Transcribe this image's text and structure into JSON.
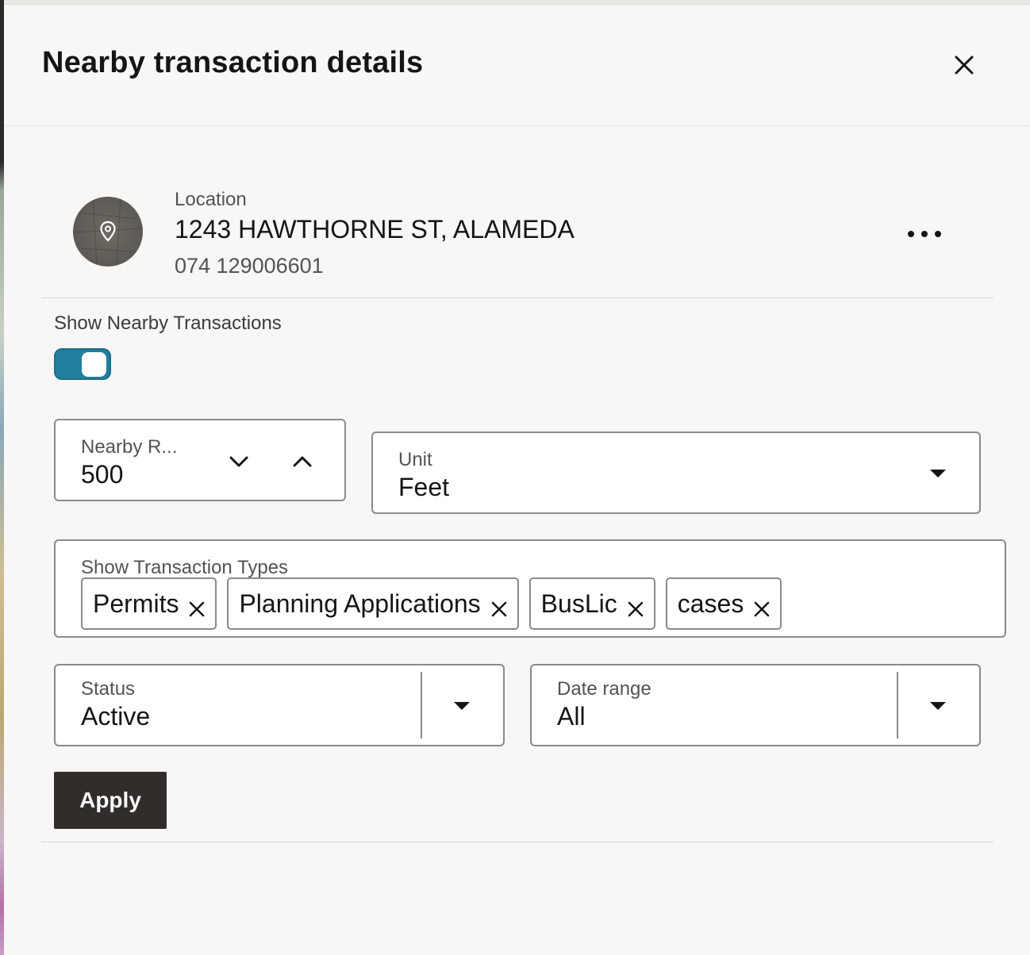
{
  "panel": {
    "title": "Nearby transaction details",
    "close_icon": "close-icon"
  },
  "location": {
    "label": "Location",
    "address": "1243 HAWTHORNE ST, ALAMEDA",
    "parcel": "074 129006601",
    "avatar_icon": "map-pin-icon",
    "more_icon": "more-horizontal-icon"
  },
  "nearby_toggle": {
    "label": "Show Nearby Transactions",
    "on": true,
    "color": "#227e9e"
  },
  "radius": {
    "label": "Nearby R...",
    "value": "500"
  },
  "unit": {
    "label": "Unit",
    "value": "Feet"
  },
  "transaction_types": {
    "label": "Show Transaction Types",
    "chips": [
      "Permits",
      "Planning Applications",
      "BusLic",
      "cases"
    ]
  },
  "status": {
    "label": "Status",
    "value": "Active"
  },
  "date_range": {
    "label": "Date range",
    "value": "All"
  },
  "apply": {
    "label": "Apply",
    "color": "#312d2a"
  }
}
